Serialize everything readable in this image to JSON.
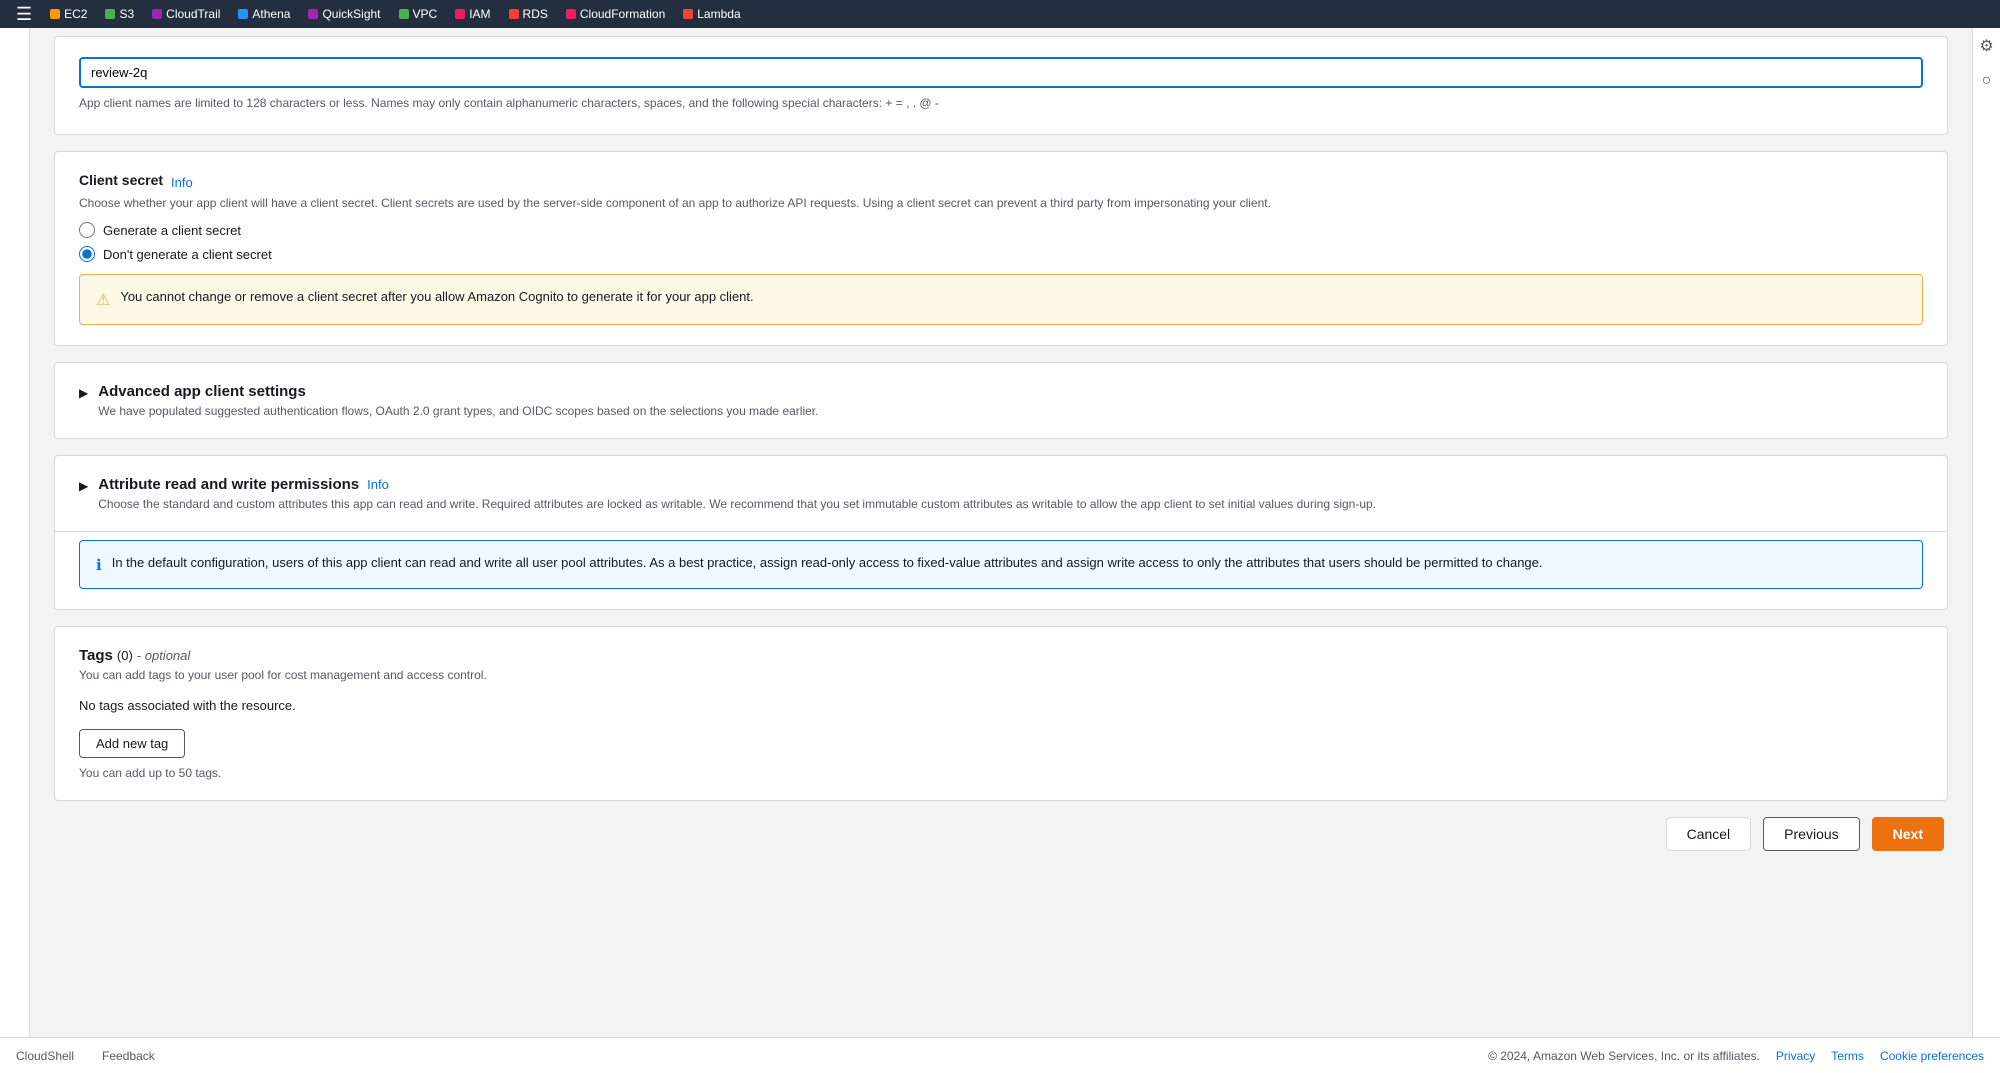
{
  "nav": {
    "items": [
      {
        "id": "ec2",
        "label": "EC2",
        "color": "#f90"
      },
      {
        "id": "s3",
        "label": "S3",
        "color": "#4caf50"
      },
      {
        "id": "cloudtrail",
        "label": "CloudTrail",
        "color": "#9c27b0"
      },
      {
        "id": "athena",
        "label": "Athena",
        "color": "#2196f3"
      },
      {
        "id": "quicksight",
        "label": "QuickSight",
        "color": "#9c27b0"
      },
      {
        "id": "vpc",
        "label": "VPC",
        "color": "#4caf50"
      },
      {
        "id": "iam",
        "label": "IAM",
        "color": "#e91e63"
      },
      {
        "id": "rds",
        "label": "RDS",
        "color": "#f44336"
      },
      {
        "id": "cloudformation",
        "label": "CloudFormation",
        "color": "#e91e63"
      },
      {
        "id": "lambda",
        "label": "Lambda",
        "color": "#f44336"
      }
    ]
  },
  "app_client": {
    "input_value": "review-2q",
    "name_hint": "App client names are limited to 128 characters or less. Names may only contain alphanumeric characters, spaces, and the following special characters: + = , . @ -"
  },
  "client_secret": {
    "label": "Client secret",
    "info_label": "Info",
    "description": "Choose whether your app client will have a client secret. Client secrets are used by the server-side component of an app to authorize API requests. Using a client secret can prevent a third party from impersonating your client.",
    "option_generate": "Generate a client secret",
    "option_dont_generate": "Don't generate a client secret",
    "warning_text": "You cannot change or remove a client secret after you allow Amazon Cognito to generate it for your app client."
  },
  "advanced_settings": {
    "title": "Advanced app client settings",
    "description": "We have populated suggested authentication flows, OAuth 2.0 grant types, and OIDC scopes based on the selections you made earlier."
  },
  "attribute_permissions": {
    "title": "Attribute read and write permissions",
    "info_label": "Info",
    "description": "Choose the standard and custom attributes this app can read and write. Required attributes are locked as writable. We recommend that you set immutable custom attributes as writable to allow the app client to set initial values during sign-up.",
    "info_box_text": "In the default configuration, users of this app client can read and write all user pool attributes. As a best practice, assign read-only access to fixed-value attributes and assign write access to only the attributes that users should be permitted to change."
  },
  "tags": {
    "title": "Tags",
    "count": "(0)",
    "optional_label": "- optional",
    "description": "You can add tags to your user pool for cost management and access control.",
    "no_tags_text": "No tags associated with the resource.",
    "add_button_label": "Add new tag",
    "tags_limit_hint": "You can add up to 50 tags."
  },
  "actions": {
    "cancel_label": "Cancel",
    "previous_label": "Previous",
    "next_label": "Next"
  },
  "footer": {
    "copyright": "© 2024, Amazon Web Services, Inc. or its affiliates.",
    "privacy_label": "Privacy",
    "terms_label": "Terms",
    "cookie_label": "Cookie preferences"
  },
  "cloudshell_label": "CloudShell",
  "feedback_label": "Feedback"
}
